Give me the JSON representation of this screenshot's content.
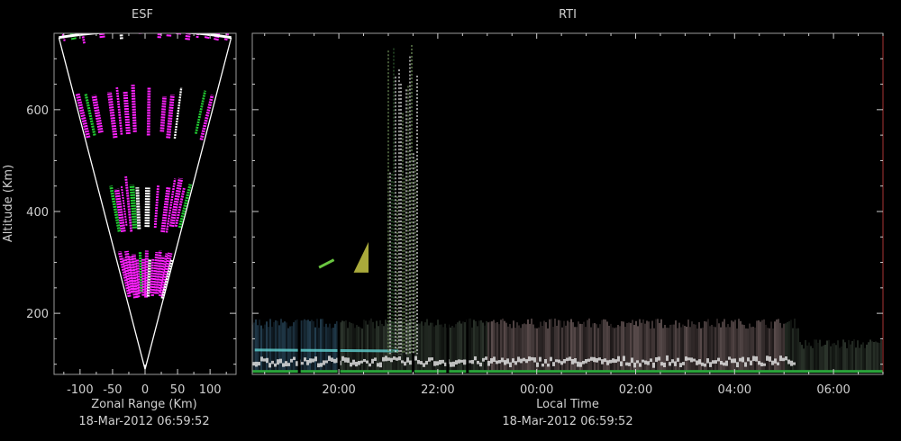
{
  "chart_data": [
    {
      "type": "scatter",
      "panel": "fan",
      "title": "ESF",
      "xlabel": "Zonal Range (Km)",
      "ylabel": "Altitude (Km)",
      "xlim": [
        -140,
        140
      ],
      "ylim": [
        80,
        750
      ],
      "xticks": [
        -100,
        -50,
        0,
        50,
        100
      ],
      "xtick_labels": [
        "-100",
        "-50",
        "0",
        "50",
        "100"
      ],
      "yticks": [
        200,
        400,
        600
      ],
      "ytick_labels": [
        "200",
        "400",
        "600"
      ],
      "timestamp": "18-Mar-2012 06:59:52",
      "fan": {
        "apex": [
          0,
          90
        ],
        "half_angle_deg": 11.5,
        "max_range_km": 665
      },
      "echo_bands_km": [
        [
          140,
          240
        ],
        [
          270,
          380
        ],
        [
          455,
          560
        ],
        [
          645,
          745
        ]
      ],
      "colors": {
        "echo": "#ff22ff",
        "strong": "#ffffff",
        "weak": "#22cc33",
        "edge": "#ffffff"
      }
    },
    {
      "type": "heatmap",
      "panel": "rti",
      "title": "RTI",
      "xlabel": "Local Time",
      "ylabel": "",
      "xlim_hours": [
        18.25,
        31.0
      ],
      "ylim": [
        80,
        750
      ],
      "xticks_hours": [
        20,
        22,
        24,
        26,
        28,
        30
      ],
      "xtick_labels": [
        "20:00",
        "22:00",
        "00:00",
        "02:00",
        "04:00",
        "06:00"
      ],
      "yticks": [
        200,
        400,
        600
      ],
      "ytick_labels": [
        "200",
        "400",
        "600"
      ],
      "timestamp": "18-Mar-2012 06:59:52",
      "layers": [
        {
          "feature": "E-region band",
          "hours": [
            18.25,
            31.0
          ],
          "alt_km": [
            85,
            180
          ],
          "color": "#7a6a66"
        },
        {
          "feature": "bottom bright echo",
          "hours": [
            18.25,
            29.2
          ],
          "alt_km": [
            90,
            120
          ],
          "color": "#e8e8e8"
        },
        {
          "feature": "plume",
          "hours": [
            21.0,
            21.6
          ],
          "alt_km": [
            120,
            740
          ],
          "color": "#dddddd"
        },
        {
          "feature": "rising wedge",
          "hours": [
            20.3,
            20.6
          ],
          "alt_km": [
            280,
            340
          ],
          "color": "#d4d44a"
        }
      ]
    }
  ]
}
